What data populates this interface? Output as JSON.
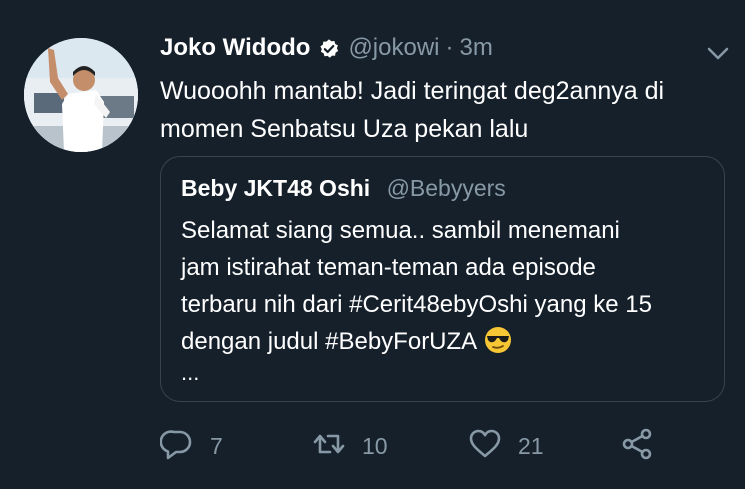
{
  "tweet": {
    "author_name": "Joko Widodo",
    "handle": "@jokowi",
    "separator": "·",
    "time": "3m",
    "text_lines": [
      "Wuooohh mantab! Jadi teringat deg2annya di",
      "momen Senbatsu Uza pekan lalu"
    ]
  },
  "quote": {
    "author_name": "Beby JKT48 Oshi",
    "handle": "@Bebyyers",
    "text_lines": [
      "Selamat siang semua.. sambil menemani",
      "jam istirahat teman-teman ada episode",
      "terbaru nih dari #Cerit48ebyOshi yang ke 15",
      "dengan judul #BebyForUZA"
    ],
    "emoji": "smiling-face-with-sunglasses",
    "ellipsis": "..."
  },
  "actions": {
    "reply_count": "7",
    "retweet_count": "10",
    "like_count": "21"
  },
  "colors": {
    "background": "#15202b",
    "secondary_text": "#8899a6",
    "border": "#38444d"
  }
}
